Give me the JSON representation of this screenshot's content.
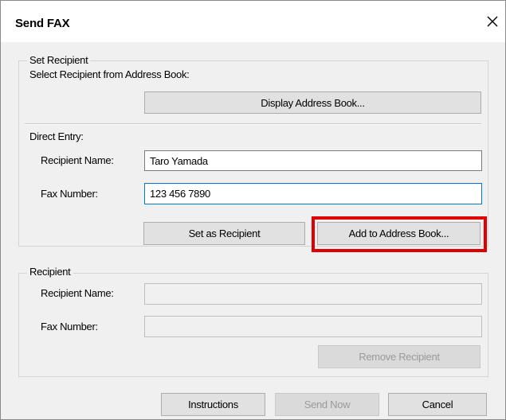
{
  "window": {
    "title": "Send FAX",
    "close_icon": "close-icon"
  },
  "set_recipient": {
    "group_title": "Set Recipient",
    "address_book_label": "Select Recipient from Address Book:",
    "display_address_book_button": "Display Address Book..."
  },
  "direct_entry": {
    "label": "Direct Entry:",
    "recipient_name_label": "Recipient Name:",
    "recipient_name_value": "Taro Yamada",
    "fax_number_label": "Fax Number:",
    "fax_number_value": "123 456 7890",
    "set_as_recipient_button": "Set as Recipient",
    "add_to_address_book_button": "Add to Address Book..."
  },
  "recipient": {
    "group_title": "Recipient",
    "recipient_name_label": "Recipient Name:",
    "recipient_name_value": "",
    "fax_number_label": "Fax Number:",
    "fax_number_value": "",
    "remove_recipient_button": "Remove Recipient"
  },
  "footer": {
    "instructions_button": "Instructions",
    "send_now_button": "Send Now",
    "cancel_button": "Cancel"
  },
  "colors": {
    "highlight": "#e00000",
    "focus_border": "#0078d7",
    "dialog_bg": "#f0f0f0"
  }
}
